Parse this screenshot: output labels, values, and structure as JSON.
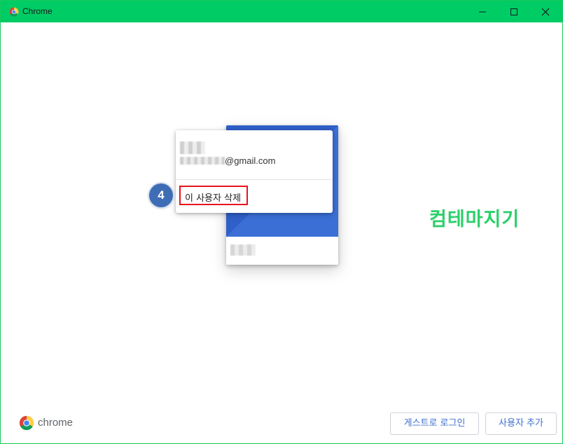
{
  "window": {
    "title": "Chrome",
    "titlebar_color": "#00cc66",
    "controls": [
      "minimize-icon",
      "maximize-icon",
      "close-icon"
    ]
  },
  "profile_menu": {
    "email_suffix": "@gmail.com",
    "remove_user_label": "이 사용자 삭제"
  },
  "annotation": {
    "step_number": "4",
    "highlight_color": "#e8141e"
  },
  "watermark": {
    "text": "컴테마지기"
  },
  "footer": {
    "brand_text": "chrome",
    "guest_button_label": "게스트로 로그인",
    "add_user_button_label": "사용자 추가"
  },
  "colors": {
    "accent": "#3c6ecf",
    "card_blue": "#3b6fd6"
  }
}
